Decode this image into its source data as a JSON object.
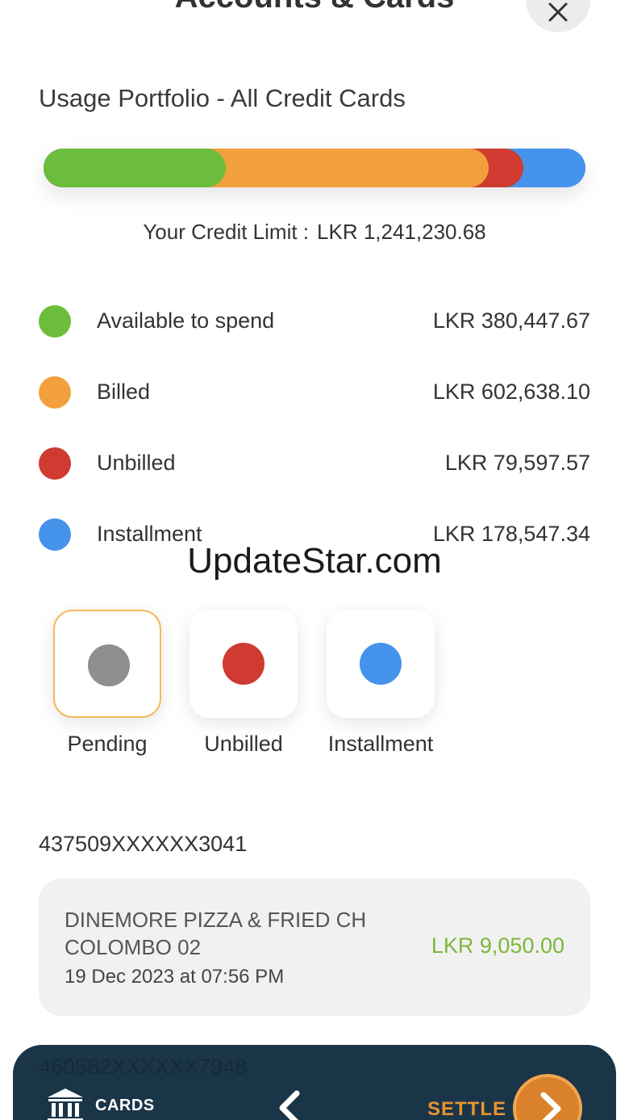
{
  "header": {
    "title": "Accounts & Cards",
    "close_icon": "close-icon"
  },
  "portfolio": {
    "title": "Usage Portfolio - All Credit Cards",
    "credit_limit_label": "Your Credit Limit :",
    "credit_limit_value": "LKR 1,241,230.68",
    "usage_segments": [
      {
        "name": "Available to spend",
        "amount": 380447.67,
        "color": "#6cbd3b"
      },
      {
        "name": "Billed",
        "amount": 602638.1,
        "color": "#f2a03d"
      },
      {
        "name": "Unbilled",
        "amount": 79597.57,
        "color": "#cf3a31"
      },
      {
        "name": "Installment",
        "amount": 178547.34,
        "color": "#4593ea"
      }
    ],
    "legend": [
      {
        "label": "Available to spend",
        "value": "LKR 380,447.67",
        "color": "#6cbd3b"
      },
      {
        "label": "Billed",
        "value": "LKR 602,638.10",
        "color": "#f2a03d"
      },
      {
        "label": "Unbilled",
        "value": "LKR 79,597.57",
        "color": "#cf3a31"
      },
      {
        "label": "Installment",
        "value": "LKR 178,547.34",
        "color": "#4593ea"
      }
    ]
  },
  "watermark": "UpdateStar.com",
  "filters": [
    {
      "label": "Pending",
      "color": "#8f8f8f",
      "selected": true
    },
    {
      "label": "Unbilled",
      "color": "#cf3a31",
      "selected": false
    },
    {
      "label": "Installment",
      "color": "#4593ea",
      "selected": false
    }
  ],
  "transactions": {
    "card_number": "437509XXXXXX3041",
    "items": [
      {
        "merchant": "DINEMORE PIZZA & FRIED CH\nCOLOMBO 02",
        "date": "19 Dec 2023 at 07:56 PM",
        "amount": "LKR 9,050.00",
        "amount_color": "#7ab83a"
      }
    ],
    "next_card_number": "460582XXXXXX7948"
  },
  "bottom_nav": {
    "cards_label": "CARDS",
    "cards_icon": "bank-icon",
    "back_icon": "chevron-left-icon",
    "settle_label": "SETTLE",
    "settle_icon": "chevron-right-icon",
    "background_color": "#1b3548",
    "accent_color": "#e8932f"
  }
}
